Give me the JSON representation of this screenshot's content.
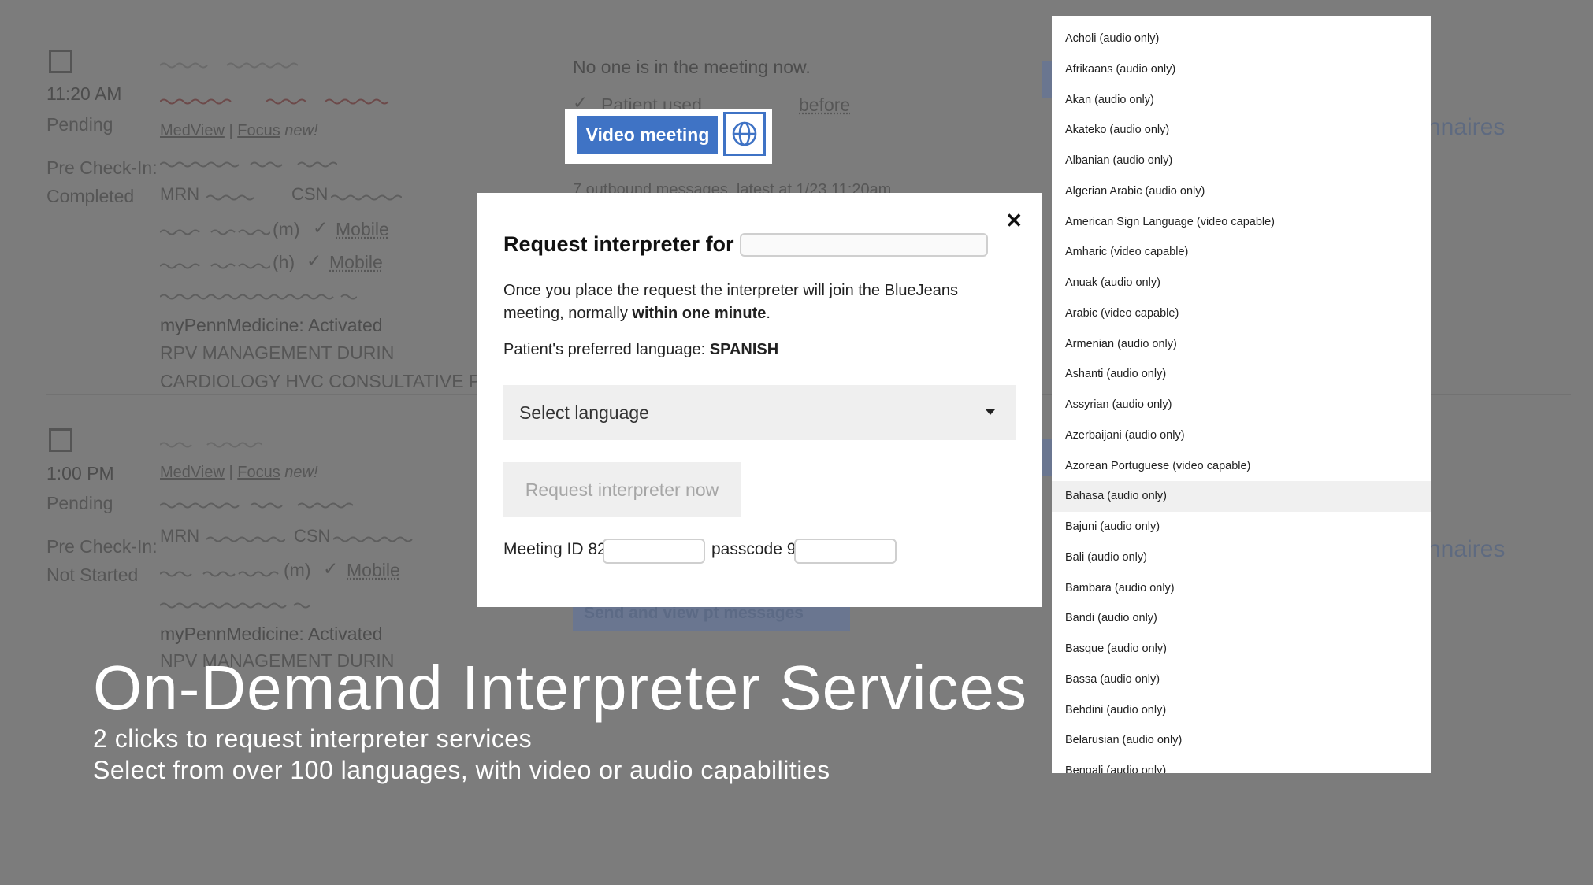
{
  "background": {
    "appt1": {
      "time": "11:20 AM",
      "status": "Pending",
      "precheck_label": "Pre Check-In:",
      "precheck_value": "Completed",
      "link1": "MedView",
      "sep": "|",
      "link2": "Focus",
      "new": "new!",
      "mrn": "MRN",
      "csn": "CSN",
      "phone_m": "(m)",
      "phone_h": "(h)",
      "mobile": "Mobile",
      "portal": "myPennMedicine: Activated",
      "line_a": "RPV MANAGEMENT DURIN",
      "line_b": "CARDIOLOGY HVC CONSULTATIVE PE"
    },
    "appt2": {
      "time": "1:00 PM",
      "status": "Pending",
      "precheck_label": "Pre Check-In:",
      "precheck_value": "Not Started",
      "link1": "MedView",
      "sep": "|",
      "link2": "Focus",
      "new": "new!",
      "mrn": "MRN",
      "csn": "CSN",
      "phone_m": "(m)",
      "mobile": "Mobile",
      "portal": "myPennMedicine: Activated",
      "line_a": "NPV MANAGEMENT DURIN"
    },
    "meeting_status": "No one is in the meeting now.",
    "patient_used": "Patient used",
    "before": "before",
    "outbound": "7 outbound messages, latest at 1/23 11:20am",
    "send_view": "Send and view pt messages",
    "questionnaires_1": "nnaires",
    "questionnaires_2": "nnaires"
  },
  "video_meeting": {
    "label": "Video meeting",
    "globe_icon": "globe-icon"
  },
  "modal": {
    "title": "Request interpreter for",
    "description_pre": "Once you place the request the interpreter will join the BlueJeans meeting, normally ",
    "description_bold": "within one minute",
    "description_post": ".",
    "pref_label": "Patient's preferred language: ",
    "pref_value": "SPANISH",
    "select_placeholder": "Select language",
    "request_button": "Request interpreter now",
    "meeting_id_label": "Meeting ID 82",
    "passcode_label": "passcode 9",
    "close_icon": "close-icon"
  },
  "dropdown": {
    "items": [
      "Acholi (audio only)",
      "Afrikaans (audio only)",
      "Akan (audio only)",
      "Akateko (audio only)",
      "Albanian (audio only)",
      "Algerian Arabic (audio only)",
      "American Sign Language (video capable)",
      "Amharic (video capable)",
      "Anuak (audio only)",
      "Arabic (video capable)",
      "Armenian (audio only)",
      "Ashanti (audio only)",
      "Assyrian (audio only)",
      "Azerbaijani (audio only)",
      "Azorean Portuguese (video capable)",
      "Bahasa (audio only)",
      "Bajuni (audio only)",
      "Bali (audio only)",
      "Bambara (audio only)",
      "Bandi (audio only)",
      "Basque (audio only)",
      "Bassa (audio only)",
      "Behdini (audio only)",
      "Belarusian (audio only)",
      "Bengali (audio only)"
    ],
    "highlighted": "Bahasa (audio only)"
  },
  "slide": {
    "title": "On-Demand Interpreter Services",
    "subtitle_1": "2 clicks to request interpreter services",
    "subtitle_2": "Select from over 100 languages, with video or audio capabilities"
  }
}
